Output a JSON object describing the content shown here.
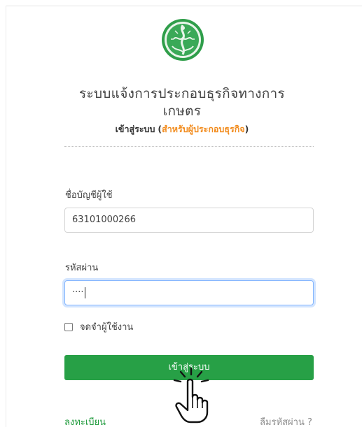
{
  "header": {
    "title_line1": "ระบบแจ้งการประกอบธุรกิจทางการ",
    "title_line2": "เกษตร",
    "subtitle_lead": "เข้าสู่ระบบ",
    "subtitle_open": "(",
    "subtitle_accent": "สำหรับผู้ประกอบธุรกิจ",
    "subtitle_close": ")"
  },
  "form": {
    "username_label": "ชื่อบัญชีผู้ใช้",
    "username_value": "63101000266",
    "password_label": "รหัสผ่าน",
    "password_value": "····",
    "remember_label": "จดจำผู้ใช้งาน",
    "login_button": "เข้าสู่ระบบ"
  },
  "links": {
    "register": "ลงทะเบียน",
    "forgot_password": "ลืมรหัสผ่าน ?"
  },
  "colors": {
    "accent_orange": "#f28c1e",
    "button_green": "#27a046",
    "link_green": "#1f9a3c"
  },
  "icons": {
    "logo": "ministry-of-agriculture-seal",
    "cursor": "hand-pointer-click-icon"
  }
}
